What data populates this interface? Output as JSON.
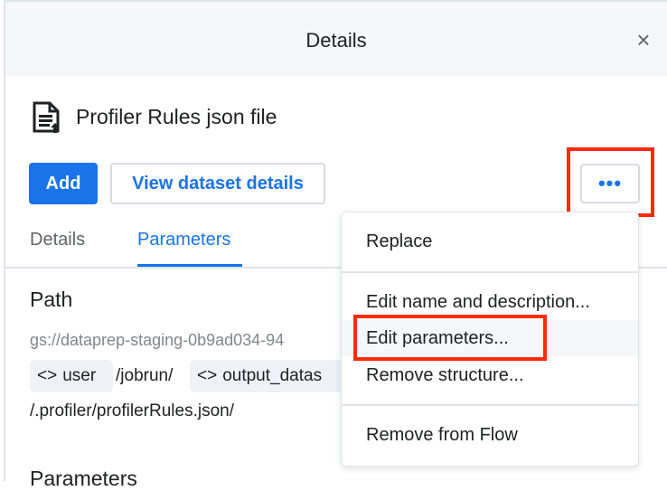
{
  "panel": {
    "title": "Details",
    "close_icon": "close-icon"
  },
  "file": {
    "title": "Profiler Rules json file",
    "icon": "file-document-icon"
  },
  "actions": {
    "add": "Add",
    "view": "View dataset details",
    "more": "•••"
  },
  "tabs": [
    {
      "label": "Details",
      "active": false
    },
    {
      "label": "Parameters",
      "active": true
    }
  ],
  "path": {
    "heading": "Path",
    "base": "gs://dataprep-staging-0b9ad034-94",
    "chip1": "user",
    "sep1": "/jobrun/",
    "chip2": "output_datas",
    "suffix": "/.profiler/profilerRules.json/"
  },
  "parameters_heading": "Parameters",
  "menu": {
    "items": [
      "Replace",
      "Edit name and description...",
      "Edit parameters...",
      "Remove structure...",
      "Remove from Flow"
    ]
  },
  "colors": {
    "accent": "#1a73e8",
    "highlight": "#ff2a0a"
  }
}
